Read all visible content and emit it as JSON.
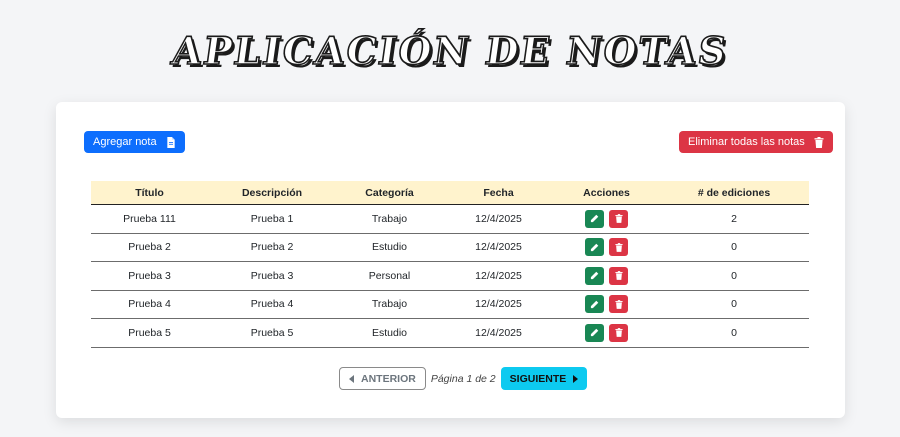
{
  "app": {
    "title": "APLICACIÓN DE NOTAS"
  },
  "toolbar": {
    "add_label": "Agregar nota",
    "add_icon": "file-icon",
    "delete_all_label": "Eliminar todas las notas",
    "delete_all_icon": "trash-icon"
  },
  "table": {
    "headers": [
      "Título",
      "Descripción",
      "Categoría",
      "Fecha",
      "Acciones",
      "# de ediciones"
    ],
    "rows": [
      {
        "title": "Prueba 111",
        "description": "Prueba 1",
        "category": "Trabajo",
        "date": "12/4/2025",
        "edits": "2"
      },
      {
        "title": "Prueba 2",
        "description": "Prueba 2",
        "category": "Estudio",
        "date": "12/4/2025",
        "edits": "0"
      },
      {
        "title": "Prueba 3",
        "description": "Prueba 3",
        "category": "Personal",
        "date": "12/4/2025",
        "edits": "0"
      },
      {
        "title": "Prueba 4",
        "description": "Prueba 4",
        "category": "Trabajo",
        "date": "12/4/2025",
        "edits": "0"
      },
      {
        "title": "Prueba 5",
        "description": "Prueba 5",
        "category": "Estudio",
        "date": "12/4/2025",
        "edits": "0"
      }
    ],
    "action_icons": {
      "edit": "pencil-icon",
      "delete": "trash-icon"
    }
  },
  "pagination": {
    "prev_label": "ANTERIOR",
    "next_label": "SIGUIENTE",
    "page_info": "Página 1 de 2"
  },
  "colors": {
    "primary": "#0d6efd",
    "danger": "#dc3545",
    "success": "#198754",
    "info": "#0dcaf0",
    "table_header_bg": "#fff3cd"
  }
}
